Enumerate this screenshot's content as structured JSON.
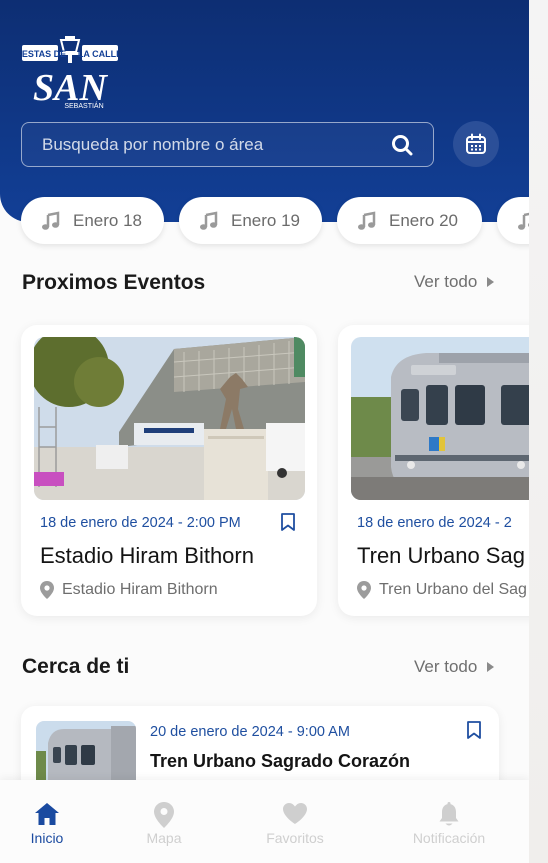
{
  "logo": {
    "top_left": "FIESTAS DE",
    "top_right": "LA CALLE",
    "main": "SAN",
    "sub": "SEBASTIÁN"
  },
  "search": {
    "placeholder": "Busqueda por nombre o área"
  },
  "date_chips": [
    {
      "label": "Enero 18"
    },
    {
      "label": "Enero 19"
    },
    {
      "label": "Enero 20"
    }
  ],
  "sections": {
    "upcoming": {
      "title": "Proximos Eventos",
      "see_all": "Ver todo"
    },
    "nearby": {
      "title": "Cerca de ti",
      "see_all": "Ver todo"
    }
  },
  "events": [
    {
      "date": "18 de enero de 2024 - 2:00 PM",
      "title": "Estadio Hiram Bithorn",
      "location": "Estadio Hiram Bithorn"
    },
    {
      "date": "18 de enero de 2024 - 2",
      "title": "Tren Urbano Sag",
      "location": "Tren Urbano del Sag"
    }
  ],
  "nearby": [
    {
      "date": "20 de enero de 2024 - 9:00 AM",
      "title": "Tren Urbano Sagrado Corazón"
    }
  ],
  "bottom_nav": [
    {
      "label": "Inicio",
      "icon": "home-icon",
      "active": true
    },
    {
      "label": "Mapa",
      "icon": "map-pin-icon",
      "active": false
    },
    {
      "label": "Favoritos",
      "icon": "heart-icon",
      "active": false
    },
    {
      "label": "Notificación",
      "icon": "bell-icon",
      "active": false
    }
  ],
  "colors": {
    "primary": "#123f96",
    "header_dark": "#0d2e73",
    "accent_text": "#1f4fa0",
    "inactive": "#cfcfcf"
  }
}
